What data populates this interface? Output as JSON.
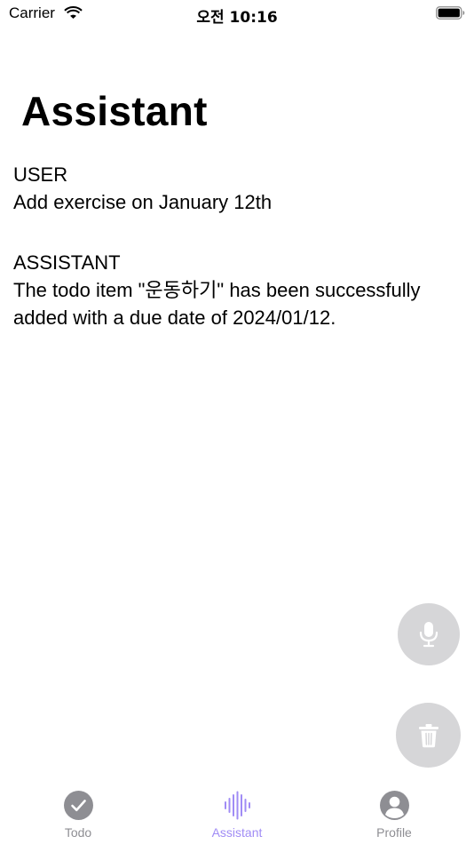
{
  "status_bar": {
    "carrier": "Carrier",
    "time": "오전 10:16"
  },
  "page": {
    "title": "Assistant"
  },
  "conversation": [
    {
      "role": "USER",
      "text": "Add exercise on January 12th"
    },
    {
      "role": "ASSISTANT",
      "text": "The todo item \"운동하기\" has been successfully added with a due date of 2024/01/12."
    }
  ],
  "fabs": {
    "mic_icon": "microphone-icon",
    "trash_icon": "trash-icon"
  },
  "tab_bar": {
    "tabs": [
      {
        "label": "Todo",
        "icon": "checkmark-circle-icon",
        "selected": false
      },
      {
        "label": "Assistant",
        "icon": "waveform-icon",
        "selected": true
      },
      {
        "label": "Profile",
        "icon": "person-circle-icon",
        "selected": false
      }
    ]
  },
  "colors": {
    "accent": "#a08cf5",
    "inactive": "#8e8e93",
    "fab_background": "#d6d6d8"
  }
}
